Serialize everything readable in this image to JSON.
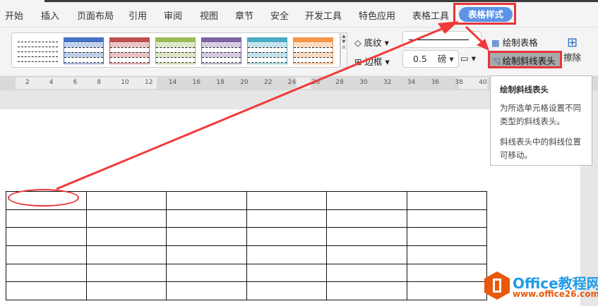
{
  "tabs": [
    "开始",
    "插入",
    "页面布局",
    "引用",
    "审阅",
    "视图",
    "章节",
    "安全",
    "开发工具",
    "特色应用",
    "表格工具"
  ],
  "active_tab": "表格样式",
  "ribbon": {
    "shading": "底纹",
    "border": "边框",
    "line_width": "0.5",
    "line_unit": "磅",
    "draw_table": "绘制表格",
    "draw_diagonal": "绘制斜线表头",
    "erase": "擦除"
  },
  "style_colors": [
    "#000000",
    "#4472c4",
    "#c0504d",
    "#9bbb59",
    "#8064a2",
    "#4bacc6",
    "#f79646"
  ],
  "ruler": [
    "2",
    "4",
    "6",
    "8",
    "10",
    "12",
    "14",
    "16",
    "18",
    "20",
    "22",
    "24",
    "26",
    "28",
    "30",
    "32",
    "34",
    "36",
    "38",
    "40"
  ],
  "tooltip": {
    "title": "绘制斜线表头",
    "line1": "为所选单元格设置不同类型的斜线表头。",
    "line2": "斜线表头中的斜线位置可移动。"
  },
  "watermark": {
    "name": "Office教程网",
    "url": "www.office26.com"
  }
}
